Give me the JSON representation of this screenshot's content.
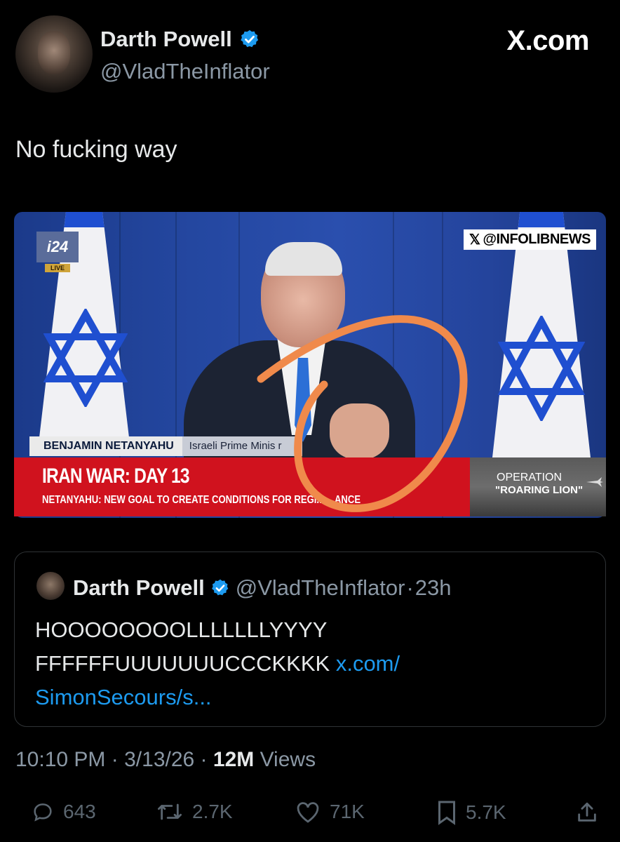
{
  "header": {
    "display_name": "Darth Powell",
    "handle": "@VladTheInflator",
    "brand": "X.com"
  },
  "tweet": {
    "text": "No fucking way"
  },
  "media": {
    "channel_logo": "i24",
    "live_label": "LIVE",
    "watermark": "@INFOLIBNEWS",
    "lower_third_name": "BENJAMIN NETANYAHU",
    "lower_third_title": "Israeli Prime Minis  r",
    "headline": "IRAN WAR: DAY 13",
    "subheadline": "NETANYAHU: NEW GOAL TO CREATE CONDITIONS FOR REGI...  ...ANCE",
    "operation_line1": "OPERATION",
    "operation_line2": "\"ROARING LION\"",
    "annotation_color": "#f08a4b"
  },
  "quoted_tweet": {
    "display_name": "Darth Powell",
    "handle": "@VladTheInflator",
    "separator": "·",
    "time": "23h",
    "text_line1": "HOOOOOOOOLLLLLLLYYYY",
    "text_line2": "FFFFFFUUUUUUUCCCKKKK",
    "link_part1": "x.com/",
    "link_part2": "SimonSecours/s..."
  },
  "meta": {
    "time": "10:10 PM",
    "date": "3/13/26",
    "separator": "·",
    "views_count": "12M",
    "views_label": "Views"
  },
  "actions": {
    "replies": "643",
    "reposts": "2.7K",
    "likes": "71K",
    "bookmarks": "5.7K"
  },
  "colors": {
    "background": "#000000",
    "verified": "#1d9bf0",
    "link": "#1d9bf0",
    "muted": "#8b98a5",
    "news_red": "#d0121e"
  }
}
